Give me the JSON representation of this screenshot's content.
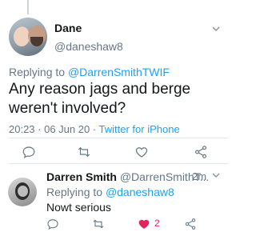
{
  "main_tweet": {
    "display_name": "Dane",
    "handle": "@daneshaw8",
    "replying_prefix": "Replying to ",
    "replying_to": "@DarrenSmithTWIF",
    "text": "Any reason jags and berge weren't involved?",
    "timestamp": "20:23 · 06 Jun 20 · ",
    "source": "Twitter for iPhone",
    "actions": [
      "reply-icon",
      "retweet-icon",
      "like-icon",
      "share-icon"
    ]
  },
  "reply_tweet": {
    "display_name": "Darren Smith",
    "handle": "@DarrenSmithT...",
    "time": "2m",
    "replying_prefix": "Replying to ",
    "replying_to": "@daneshaw8",
    "text": "Nowt serious",
    "like_count": "2",
    "liked": true,
    "actions": [
      "reply-icon",
      "retweet-icon",
      "like-icon-filled",
      "share-icon"
    ]
  },
  "colors": {
    "link": "#1da1f2",
    "secondary_text": "#657786",
    "like": "#e0245e",
    "divider": "#e1e8ed"
  }
}
